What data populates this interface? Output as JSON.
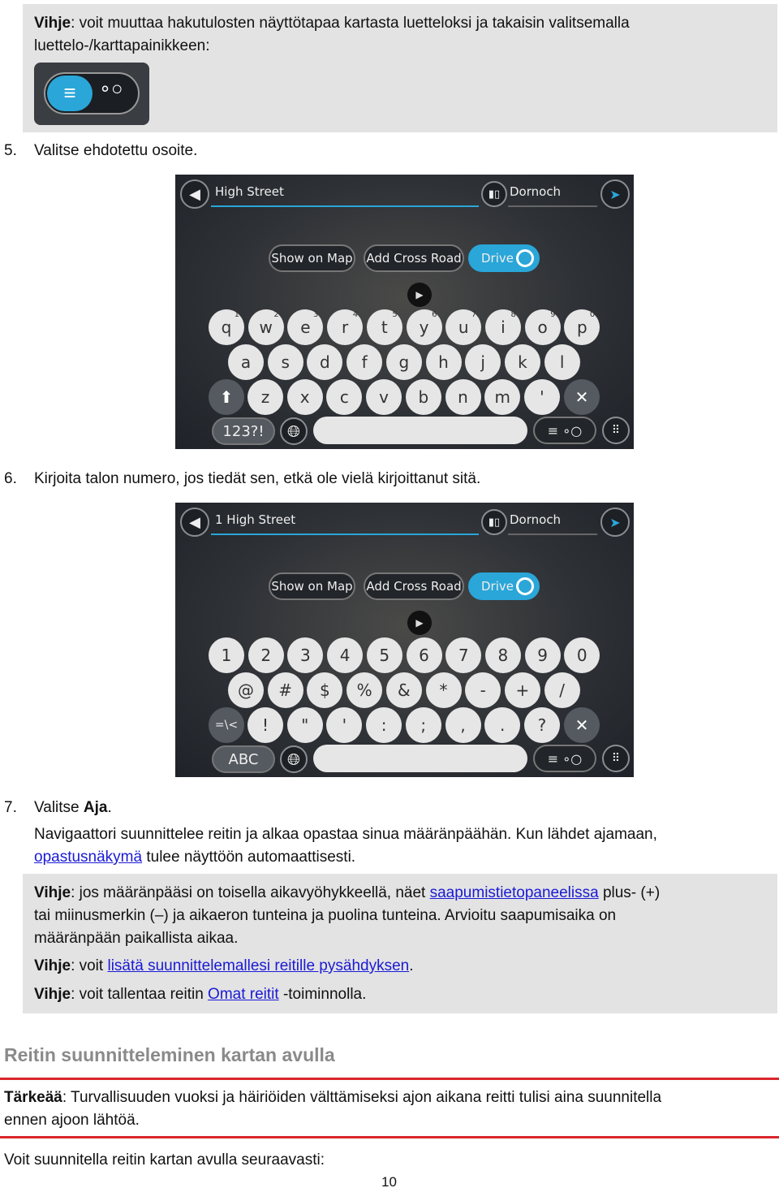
{
  "tip1": {
    "bold": "Vihje",
    "text1": ": voit muuttaa hakutulosten näyttötapaa kartasta luetteloksi ja takaisin valitsemalla",
    "text2": "luettelo-/karttapainikkeen:",
    "icon": "list-map-toggle-icon"
  },
  "step5": {
    "num": "5.",
    "text": "Valitse ehdotettu osoite."
  },
  "step6": {
    "num": "6.",
    "text": "Kirjoita talon numero, jos tiedät sen, etkä ole vielä kirjoittanut sitä."
  },
  "shot1": {
    "search": "High Street",
    "city": "Dornoch",
    "show_on_map": "Show on Map",
    "add_cross_road": "Add Cross Road",
    "drive": "Drive",
    "mode_key": "123?!",
    "rows": [
      [
        "q",
        "w",
        "e",
        "r",
        "t",
        "y",
        "u",
        "i",
        "o",
        "p"
      ],
      [
        "a",
        "s",
        "d",
        "f",
        "g",
        "h",
        "j",
        "k",
        "l"
      ],
      [
        "z",
        "x",
        "c",
        "v",
        "b",
        "n",
        "m",
        "'"
      ]
    ],
    "sups": [
      "1",
      "2",
      "3",
      "4",
      "5",
      "6",
      "7",
      "8",
      "9",
      "0"
    ]
  },
  "shot2": {
    "search": "1 High Street",
    "city": "Dornoch",
    "show_on_map": "Show on Map",
    "add_cross_road": "Add Cross Road",
    "drive": "Drive",
    "mode_key": "ABC",
    "rows": [
      [
        "1",
        "2",
        "3",
        "4",
        "5",
        "6",
        "7",
        "8",
        "9",
        "0"
      ],
      [
        "@",
        "#",
        "$",
        "%",
        "&",
        "*",
        "-",
        "+",
        "/"
      ],
      [
        "!",
        "\"",
        "'",
        ":",
        ";",
        ",",
        ".",
        "?"
      ]
    ],
    "first_key": "=\\<"
  },
  "step7": {
    "num": "7.",
    "pre": "Valitse ",
    "bold": "Aja",
    "post": ".",
    "desc1": "Navigaattori suunnittelee reitin ja alkaa opastaa sinua määränpäähän. Kun lähdet ajamaan,",
    "link": "opastusnäkymä",
    "desc2": " tulee näyttöön automaattisesti."
  },
  "tip2": {
    "bold": "Vihje",
    "pre": ": jos määränpääsi on toisella aikavyöhykkeellä, näet ",
    "link": "saapumistietopaneelissa",
    "post": " plus- (+)",
    "line2": "tai miinusmerkin (–) ja aikaeron tunteina ja puolina tunteina. Arvioitu saapumisaika on",
    "line3": "määränpään paikallista aikaa."
  },
  "tip3": {
    "bold": "Vihje",
    "pre": ": voit ",
    "link": "lisätä suunnittelemallesi reitille pysähdyksen",
    "post": "."
  },
  "tip4": {
    "bold": "Vihje",
    "pre": ": voit tallentaa reitin ",
    "link": "Omat reitit",
    "post": " -toiminnolla."
  },
  "section": {
    "title": "Reitin suunnitteleminen kartan avulla"
  },
  "important": {
    "bold": "Tärkeää",
    "text1": ": Turvallisuuden vuoksi ja häiriöiden välttämiseksi ajon aikana reitti tulisi aina suunnitella",
    "text2": "ennen ajoon lähtöä."
  },
  "intro": "Voit suunnitella reitin kartan avulla seuraavasti:",
  "page_number": "10",
  "colors": {
    "accent": "#2aa6d8",
    "rule": "#d9262b",
    "link": "#1a1ad6",
    "tip_bg": "#e3e3e3"
  }
}
